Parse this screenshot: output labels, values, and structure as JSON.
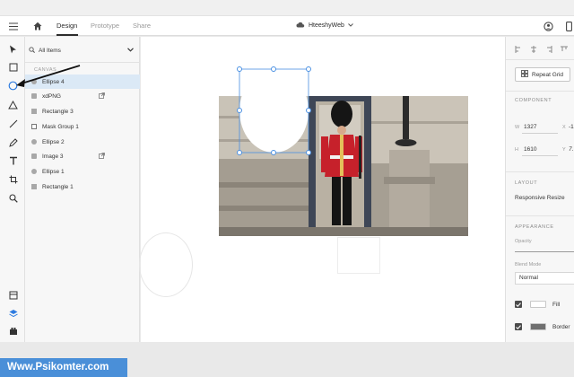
{
  "header": {
    "tabs": [
      {
        "label": "Design",
        "active": true
      },
      {
        "label": "Prototype",
        "active": false
      },
      {
        "label": "Share",
        "active": false
      }
    ],
    "document_title": "HteeshyWeb",
    "icons": [
      "hamburger-icon",
      "home-icon",
      "cloud-icon",
      "chevron-down-icon",
      "help-icon",
      "mobile-preview-icon"
    ]
  },
  "toolbar": {
    "tools": [
      "select-icon",
      "rectangle-icon",
      "ellipse-icon",
      "triangle-icon",
      "line-icon",
      "pen-icon",
      "text-icon",
      "artboard-icon",
      "zoom-icon"
    ],
    "bottom": [
      "assets-icon",
      "layers-icon",
      "plugins-icon"
    ],
    "active_tool": "ellipse-icon"
  },
  "layers_panel": {
    "filter_label": "All Items",
    "canvas_label": "CANVAS",
    "items": [
      {
        "label": "Ellipse 4",
        "type": "ellipse",
        "selected": true
      },
      {
        "label": "xdPNG",
        "type": "image",
        "linked": true
      },
      {
        "label": "Rectangle 3",
        "type": "rect"
      },
      {
        "label": "Mask Group 1",
        "type": "mask"
      },
      {
        "label": "Ellipse 2",
        "type": "ellipse"
      },
      {
        "label": "Image 3",
        "type": "image",
        "linked": true
      },
      {
        "label": "Ellipse 1",
        "type": "ellipse"
      },
      {
        "label": "Rectangle 1",
        "type": "rect"
      }
    ]
  },
  "property_panel": {
    "repeat_grid_label": "Repeat Grid",
    "component_title": "COMPONENT",
    "w_label": "W",
    "w_value": "1327",
    "h_label": "H",
    "h_value": "1610",
    "x_label": "X",
    "x_value": "-1",
    "y_label": "Y",
    "y_value": "7.",
    "layout_title": "LAYOUT",
    "responsive_label": "Responsive Resize",
    "appearance_title": "APPEARANCE",
    "opacity_label": "Opacity",
    "blend_label": "Blend Mode",
    "blend_value": "Normal",
    "fill_label": "Fill",
    "fill_checked": true,
    "fill_color": "#ffffff",
    "border_label": "Border",
    "border_checked": true,
    "border_color": "#707070"
  },
  "watermark": "Www.Psikomter.com",
  "colors": {
    "selection": "#4a90e2",
    "selected_row": "#dbe9f6",
    "watermark_bg": "#4a8fd8"
  }
}
